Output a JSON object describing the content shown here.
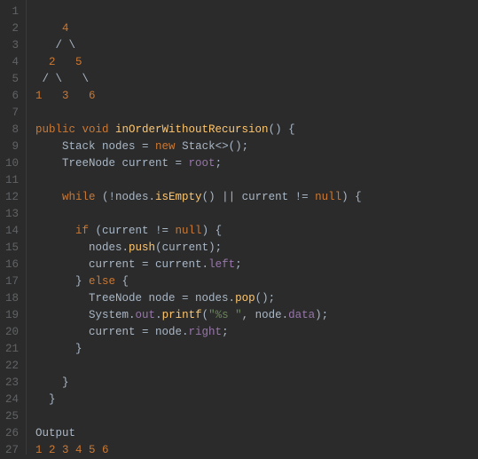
{
  "lines": [
    {
      "ln": "1",
      "tokens": []
    },
    {
      "ln": "2",
      "tokens": [
        {
          "t": "    4",
          "c": "c-tree"
        }
      ]
    },
    {
      "ln": "3",
      "tokens": [
        {
          "t": "   / \\",
          "c": "c-punc"
        }
      ]
    },
    {
      "ln": "4",
      "tokens": [
        {
          "t": "  2   5",
          "c": "c-tree"
        }
      ]
    },
    {
      "ln": "5",
      "tokens": [
        {
          "t": " / \\   \\",
          "c": "c-punc"
        }
      ]
    },
    {
      "ln": "6",
      "tokens": [
        {
          "t": "1   3   6",
          "c": "c-tree"
        }
      ]
    },
    {
      "ln": "7",
      "tokens": []
    },
    {
      "ln": "8",
      "tokens": [
        {
          "t": "public void ",
          "c": "c-kw"
        },
        {
          "t": "inOrderWithoutRecursion",
          "c": "c-method"
        },
        {
          "t": "() {",
          "c": "c-punc"
        }
      ]
    },
    {
      "ln": "9",
      "tokens": [
        {
          "t": "    Stack nodes = ",
          "c": "c-type"
        },
        {
          "t": "new ",
          "c": "c-kw"
        },
        {
          "t": "Stack<>();",
          "c": "c-type"
        }
      ]
    },
    {
      "ln": "10",
      "tokens": [
        {
          "t": "    TreeNode current = ",
          "c": "c-type"
        },
        {
          "t": "root",
          "c": "c-field"
        },
        {
          "t": ";",
          "c": "c-punc"
        }
      ]
    },
    {
      "ln": "11",
      "tokens": []
    },
    {
      "ln": "12",
      "tokens": [
        {
          "t": "    while ",
          "c": "c-kw"
        },
        {
          "t": "(!nodes.",
          "c": "c-type"
        },
        {
          "t": "isEmpty",
          "c": "c-method"
        },
        {
          "t": "() || current != ",
          "c": "c-type"
        },
        {
          "t": "null",
          "c": "c-kw"
        },
        {
          "t": ") {",
          "c": "c-punc"
        }
      ]
    },
    {
      "ln": "13",
      "tokens": []
    },
    {
      "ln": "14",
      "tokens": [
        {
          "t": "      if ",
          "c": "c-kw"
        },
        {
          "t": "(current != ",
          "c": "c-type"
        },
        {
          "t": "null",
          "c": "c-kw"
        },
        {
          "t": ") {",
          "c": "c-punc"
        }
      ]
    },
    {
      "ln": "15",
      "tokens": [
        {
          "t": "        nodes.",
          "c": "c-type"
        },
        {
          "t": "push",
          "c": "c-method"
        },
        {
          "t": "(current);",
          "c": "c-type"
        }
      ]
    },
    {
      "ln": "16",
      "tokens": [
        {
          "t": "        current = current.",
          "c": "c-type"
        },
        {
          "t": "left",
          "c": "c-field"
        },
        {
          "t": ";",
          "c": "c-punc"
        }
      ]
    },
    {
      "ln": "17",
      "tokens": [
        {
          "t": "      } ",
          "c": "c-punc"
        },
        {
          "t": "else ",
          "c": "c-kw"
        },
        {
          "t": "{",
          "c": "c-punc"
        }
      ]
    },
    {
      "ln": "18",
      "tokens": [
        {
          "t": "        TreeNode node = nodes.",
          "c": "c-type"
        },
        {
          "t": "pop",
          "c": "c-method"
        },
        {
          "t": "();",
          "c": "c-type"
        }
      ]
    },
    {
      "ln": "19",
      "tokens": [
        {
          "t": "        System.",
          "c": "c-type"
        },
        {
          "t": "out",
          "c": "c-field"
        },
        {
          "t": ".",
          "c": "c-type"
        },
        {
          "t": "printf",
          "c": "c-method"
        },
        {
          "t": "(",
          "c": "c-type"
        },
        {
          "t": "\"%s \"",
          "c": "c-str"
        },
        {
          "t": ", node.",
          "c": "c-type"
        },
        {
          "t": "data",
          "c": "c-field"
        },
        {
          "t": ");",
          "c": "c-type"
        }
      ]
    },
    {
      "ln": "20",
      "tokens": [
        {
          "t": "        current = node.",
          "c": "c-type"
        },
        {
          "t": "right",
          "c": "c-field"
        },
        {
          "t": ";",
          "c": "c-punc"
        }
      ]
    },
    {
      "ln": "21",
      "tokens": [
        {
          "t": "      }",
          "c": "c-punc"
        }
      ]
    },
    {
      "ln": "22",
      "tokens": []
    },
    {
      "ln": "23",
      "tokens": [
        {
          "t": "    }",
          "c": "c-punc"
        }
      ]
    },
    {
      "ln": "24",
      "tokens": [
        {
          "t": "  }",
          "c": "c-punc"
        }
      ]
    },
    {
      "ln": "25",
      "tokens": []
    },
    {
      "ln": "26",
      "tokens": [
        {
          "t": "Output",
          "c": "c-type"
        }
      ]
    },
    {
      "ln": "27",
      "tokens": [
        {
          "t": "1 2 3 4 5 6",
          "c": "c-out"
        }
      ]
    }
  ]
}
